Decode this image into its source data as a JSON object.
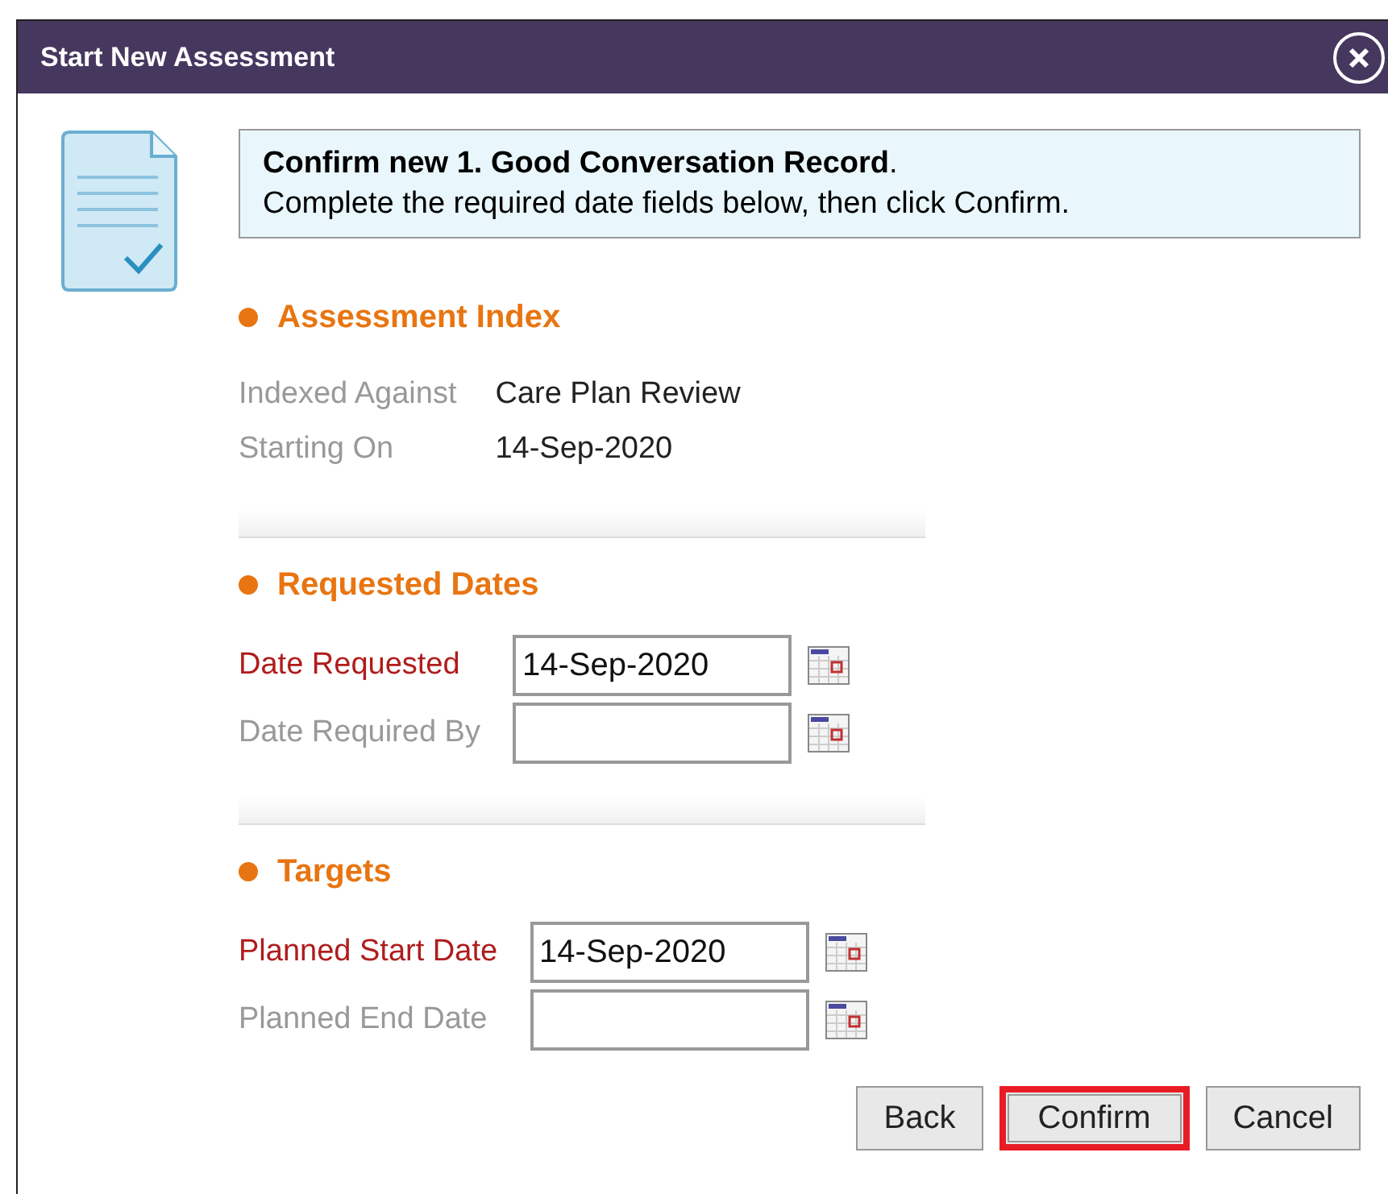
{
  "window": {
    "title": "Start New Assessment"
  },
  "message": {
    "heading": "Confirm new 1. Good Conversation Record",
    "heading_end": ".",
    "text": "Complete the required date fields below, then click Confirm."
  },
  "sections": [
    {
      "title": "Assessment Index",
      "kind": "info",
      "rows": [
        {
          "label": "Indexed Against",
          "value": "Care Plan Review"
        },
        {
          "label": "Starting On",
          "value": "14-Sep-2020"
        }
      ]
    },
    {
      "title": "Requested Dates",
      "kind": "dates",
      "rows": [
        {
          "label": "Date Requested",
          "required": true,
          "value": "14-Sep-2020"
        },
        {
          "label": "Date Required By",
          "required": false
        }
      ]
    },
    {
      "title": "Targets",
      "kind": "dates",
      "rows": [
        {
          "label": "Planned Start Date",
          "required": true,
          "value": "14-Sep-2020"
        },
        {
          "label": "Planned End Date",
          "required": false
        }
      ]
    }
  ],
  "buttons": [
    {
      "label": "Back",
      "highlighted": false
    },
    {
      "label": "Confirm",
      "highlighted": true
    },
    {
      "label": "Cancel",
      "highlighted": false
    }
  ]
}
